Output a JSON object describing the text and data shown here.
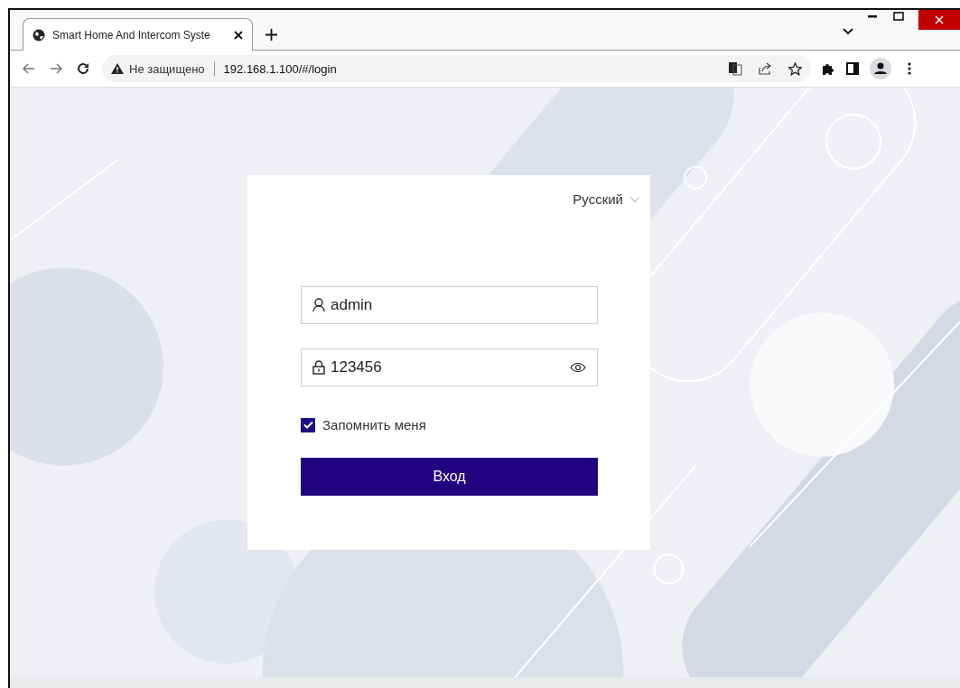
{
  "browser": {
    "tab_title": "Smart Home And Intercom Syste",
    "security": "Не защищено",
    "url": "192.168.1.100/#/login"
  },
  "login": {
    "language": "Русский",
    "username": {
      "value": "admin"
    },
    "password": {
      "value": "123456"
    },
    "remember": {
      "label": "Запомнить меня",
      "checked": true
    },
    "submit": "Вход"
  }
}
